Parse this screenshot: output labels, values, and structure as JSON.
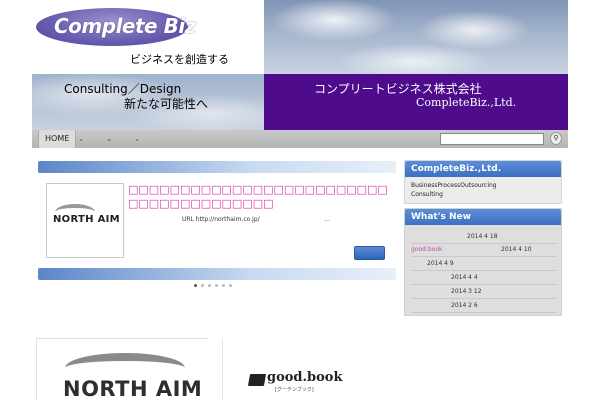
{
  "header": {
    "logo_text": "Complete Biz",
    "tagline": "ビジネスを創造する",
    "consulting_line1": "Consulting／Design",
    "consulting_line2": "新たな可能性へ",
    "company_name_jp": "コンプリートビジネス株式会社",
    "company_name_en": "CompleteBiz.,Ltd."
  },
  "nav": {
    "home_label": "HOME",
    "dropdown_icon": "chevron-down-icon",
    "search_placeholder": "",
    "search_icon": "search-icon"
  },
  "slider": {
    "thumb_logo": "NORTH AIM",
    "title": "□□□□□□□□□□□□□□□□□□□□□□□□□□□□□□□□□□□□□□□",
    "url_text": "URL http://northaim.co.jp/",
    "more_text": "...",
    "dots_total": 6,
    "dots_active_index": 0
  },
  "sidebar": {
    "company_card": {
      "title": "CompleteBiz.,Ltd.",
      "lines": [
        "BusinessProcessOutsourcing",
        "Consulting"
      ]
    },
    "whats_new": {
      "title": "What's New",
      "items": [
        {
          "link": "",
          "date": "2014 4 18"
        },
        {
          "link": "good.book",
          "date": "2014 4 10"
        },
        {
          "link": "",
          "date": "2014 4 9"
        },
        {
          "link": "",
          "date": "2014 4 4"
        },
        {
          "link": "",
          "date": "2014 3 12"
        },
        {
          "link": "",
          "date": "2014 2 6"
        }
      ]
    }
  },
  "banners": {
    "north_aim": "NORTH AIM",
    "good_book": "good.book",
    "good_book_sub": "[グーテンブック]"
  },
  "colors": {
    "header_purple": "#4e0c8c",
    "accent_blue": "#3c6fbf",
    "link_pink": "#d233a8"
  }
}
